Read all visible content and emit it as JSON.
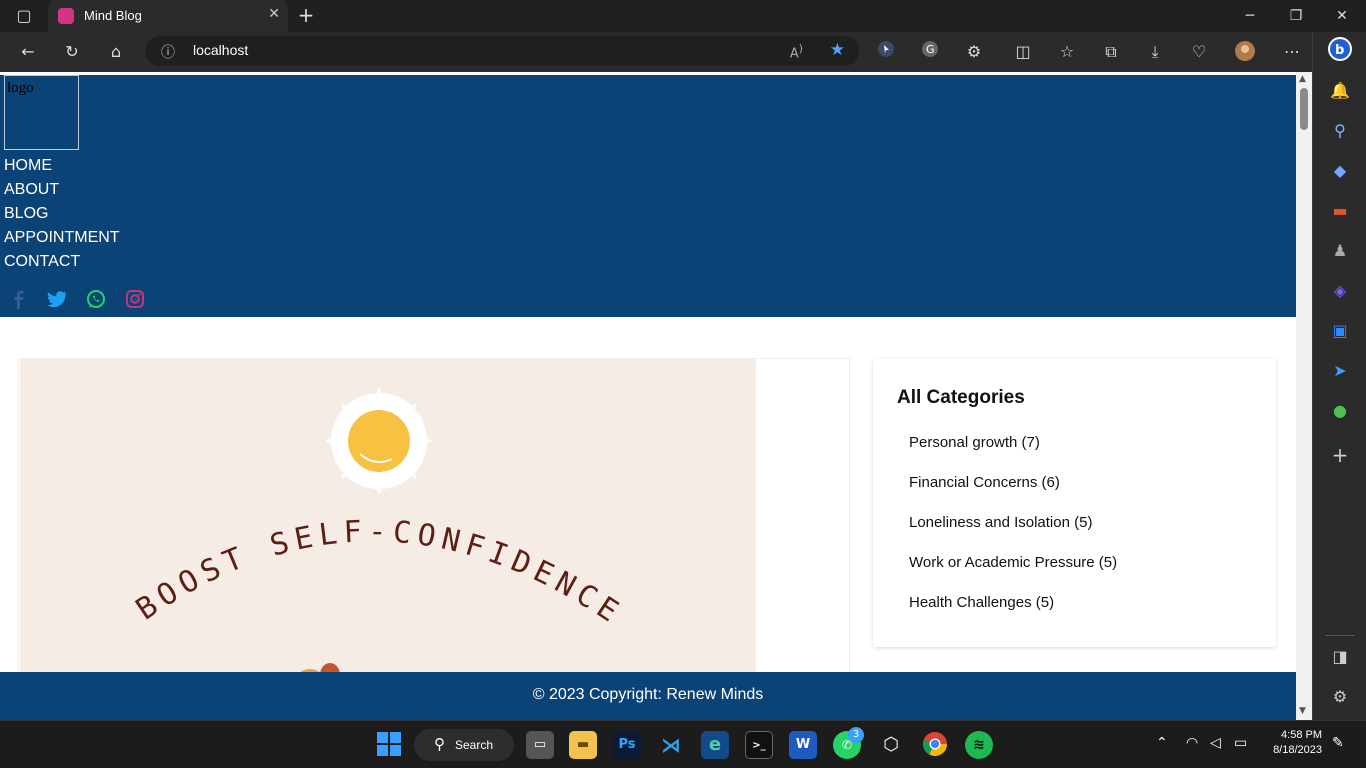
{
  "browser": {
    "tab_title": "Mind Blog",
    "url": "localhost",
    "read_aloud_label": "A̅",
    "tab_close": "✕",
    "new_tab": "+"
  },
  "page": {
    "logo_alt": "logo",
    "nav": [
      "HOME",
      "ABOUT",
      "BLOG",
      "APPOINTMENT",
      "CONTACT"
    ],
    "post_image_text": "BOOST SELF-CONFIDENCE",
    "categories_title": "All Categories",
    "categories": [
      "Personal growth (7)",
      "Financial Concerns (6)",
      "Loneliness and Isolation (5)",
      "Work or Academic Pressure (5)",
      "Health Challenges (5)"
    ],
    "footer": "© 2023 Copyright: Renew Minds"
  },
  "taskbar": {
    "search_label": "Search",
    "whatsapp_badge": "3",
    "time": "4:58 PM",
    "date": "8/18/2023"
  },
  "colors": {
    "header_bg": "#0c4377",
    "facebook": "#3b5998",
    "twitter": "#1da1f2",
    "whatsapp": "#25d366",
    "instagram": "#c13584"
  }
}
